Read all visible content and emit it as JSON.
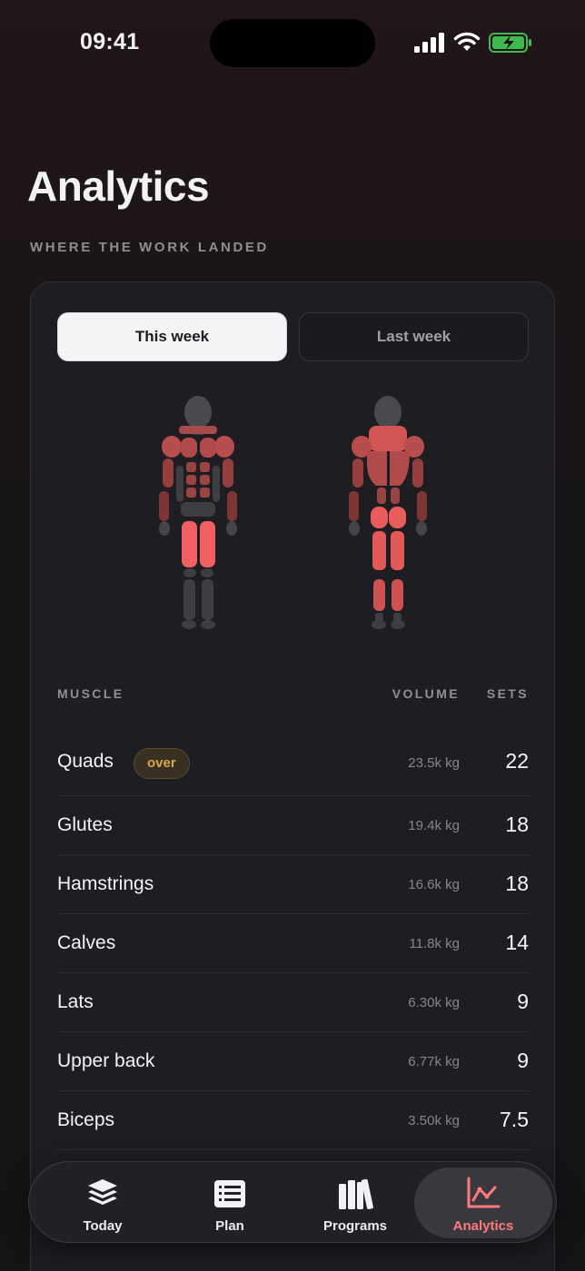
{
  "status_bar": {
    "time": "09:41"
  },
  "header": {
    "title": "Analytics",
    "subtitle": "WHERE THE WORK LANDED"
  },
  "range_toggle": {
    "options": [
      "This week",
      "Last week"
    ],
    "selected": "This week"
  },
  "table": {
    "headers": {
      "muscle": "MUSCLE",
      "volume": "VOLUME",
      "sets": "SETS"
    },
    "rows": [
      {
        "muscle": "Quads",
        "badge": "over",
        "volume": "23.5k kg",
        "sets": "22"
      },
      {
        "muscle": "Glutes",
        "volume": "19.4k kg",
        "sets": "18"
      },
      {
        "muscle": "Hamstrings",
        "volume": "16.6k kg",
        "sets": "18"
      },
      {
        "muscle": "Calves",
        "volume": "11.8k kg",
        "sets": "14"
      },
      {
        "muscle": "Lats",
        "volume": "6.30k kg",
        "sets": "9"
      },
      {
        "muscle": "Upper back",
        "volume": "6.77k kg",
        "sets": "9"
      },
      {
        "muscle": "Biceps",
        "volume": "3.50k kg",
        "sets": "7.5"
      }
    ]
  },
  "tab_bar": {
    "items": [
      {
        "label": "Today",
        "icon": "layers-icon"
      },
      {
        "label": "Plan",
        "icon": "list-icon"
      },
      {
        "label": "Programs",
        "icon": "books-icon"
      },
      {
        "label": "Analytics",
        "icon": "chart-icon",
        "active": true
      }
    ]
  },
  "colors": {
    "accent": "#ff7b7b",
    "badge": "#d4a94a",
    "background": "#141416",
    "card": "#1e1e22"
  }
}
